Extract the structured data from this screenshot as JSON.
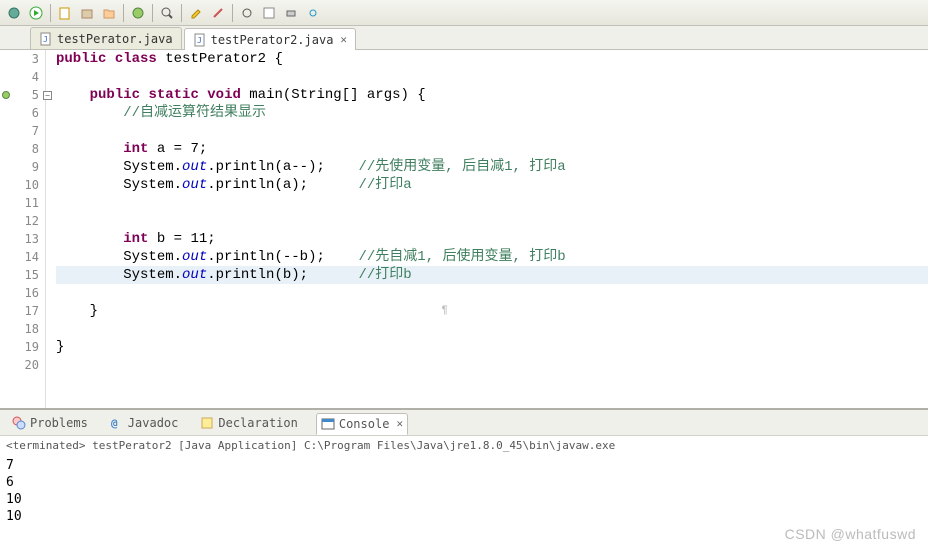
{
  "tabs": [
    {
      "label": "testPerator.java",
      "active": false
    },
    {
      "label": "testPerator2.java",
      "active": true
    }
  ],
  "code": {
    "lines": [
      {
        "n": 3,
        "html": "<span class='kw'>public</span> <span class='kw'>class</span> testPerator2 {"
      },
      {
        "n": 4,
        "html": ""
      },
      {
        "n": 5,
        "html": "    <span class='kw'>public</span> <span class='kw'>static</span> <span class='kw'>void</span> main(String[] args) {",
        "fold": true
      },
      {
        "n": 6,
        "html": "        <span class='cm'>//自减运算符结果显示</span>"
      },
      {
        "n": 7,
        "html": ""
      },
      {
        "n": 8,
        "html": "        <span class='kw'>int</span> a = 7;"
      },
      {
        "n": 9,
        "html": "        System.<span class='fld'>out</span>.println(a--);    <span class='cm'>//先使用变量, 后自减1, 打印a</span>"
      },
      {
        "n": 10,
        "html": "        System.<span class='fld'>out</span>.println(a);      <span class='cm'>//打印a</span>"
      },
      {
        "n": 11,
        "html": ""
      },
      {
        "n": 12,
        "html": ""
      },
      {
        "n": 13,
        "html": "        <span class='kw'>int</span> b = 11;"
      },
      {
        "n": 14,
        "html": "        System.<span class='fld'>out</span>.println(--b);    <span class='cm'>//先自减1, 后使用变量, 打印b</span>"
      },
      {
        "n": 15,
        "html": "        System.<span class='fld'>out</span>.println(b);      <span class='cm'>//打印b</span>",
        "hl": true
      },
      {
        "n": 16,
        "html": ""
      },
      {
        "n": 17,
        "html": "    }",
        "ws": true
      },
      {
        "n": 18,
        "html": ""
      },
      {
        "n": 19,
        "html": "}"
      },
      {
        "n": 20,
        "html": ""
      }
    ]
  },
  "bottom_tabs": {
    "problems": "Problems",
    "javadoc": "Javadoc",
    "declaration": "Declaration",
    "console": "Console"
  },
  "console": {
    "header": "<terminated> testPerator2 [Java Application] C:\\Program Files\\Java\\jre1.8.0_45\\bin\\javaw.exe",
    "output": [
      "7",
      "6",
      "10",
      "10"
    ]
  },
  "watermark": "CSDN @whatfuswd"
}
